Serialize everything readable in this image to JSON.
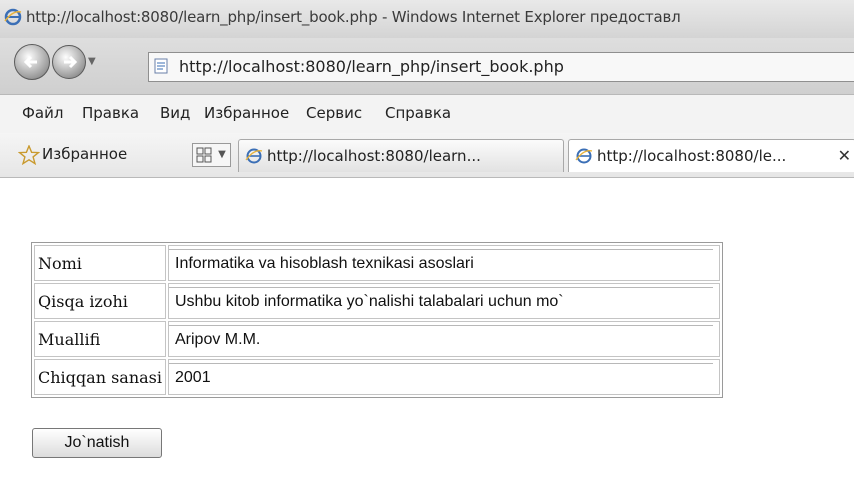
{
  "window": {
    "title": "http://localhost:8080/learn_php/insert_book.php - Windows Internet Explorer предоставл"
  },
  "addressbar": {
    "url": "http://localhost:8080/learn_php/insert_book.php"
  },
  "menubar": {
    "items": [
      "Файл",
      "Правка",
      "Вид",
      "Избранное",
      "Сервис",
      "Справка"
    ]
  },
  "favorites": {
    "label": "Избранное",
    "tabs": [
      {
        "label": "http://localhost:8080/learn..."
      },
      {
        "label": "http://localhost:8080/le..."
      }
    ]
  },
  "form": {
    "rows": [
      {
        "label": "Nomi",
        "value": "Informatika va hisoblash texnikasi asoslari"
      },
      {
        "label": "Qisqa izohi",
        "value": "Ushbu kitob informatika yo`nalishi talabalari uchun mo`"
      },
      {
        "label": "Muallifi",
        "value": "Aripov M.M."
      },
      {
        "label": "Chiqqan sanasi",
        "value": "2001"
      }
    ],
    "submit_label": "Jo`natish"
  }
}
